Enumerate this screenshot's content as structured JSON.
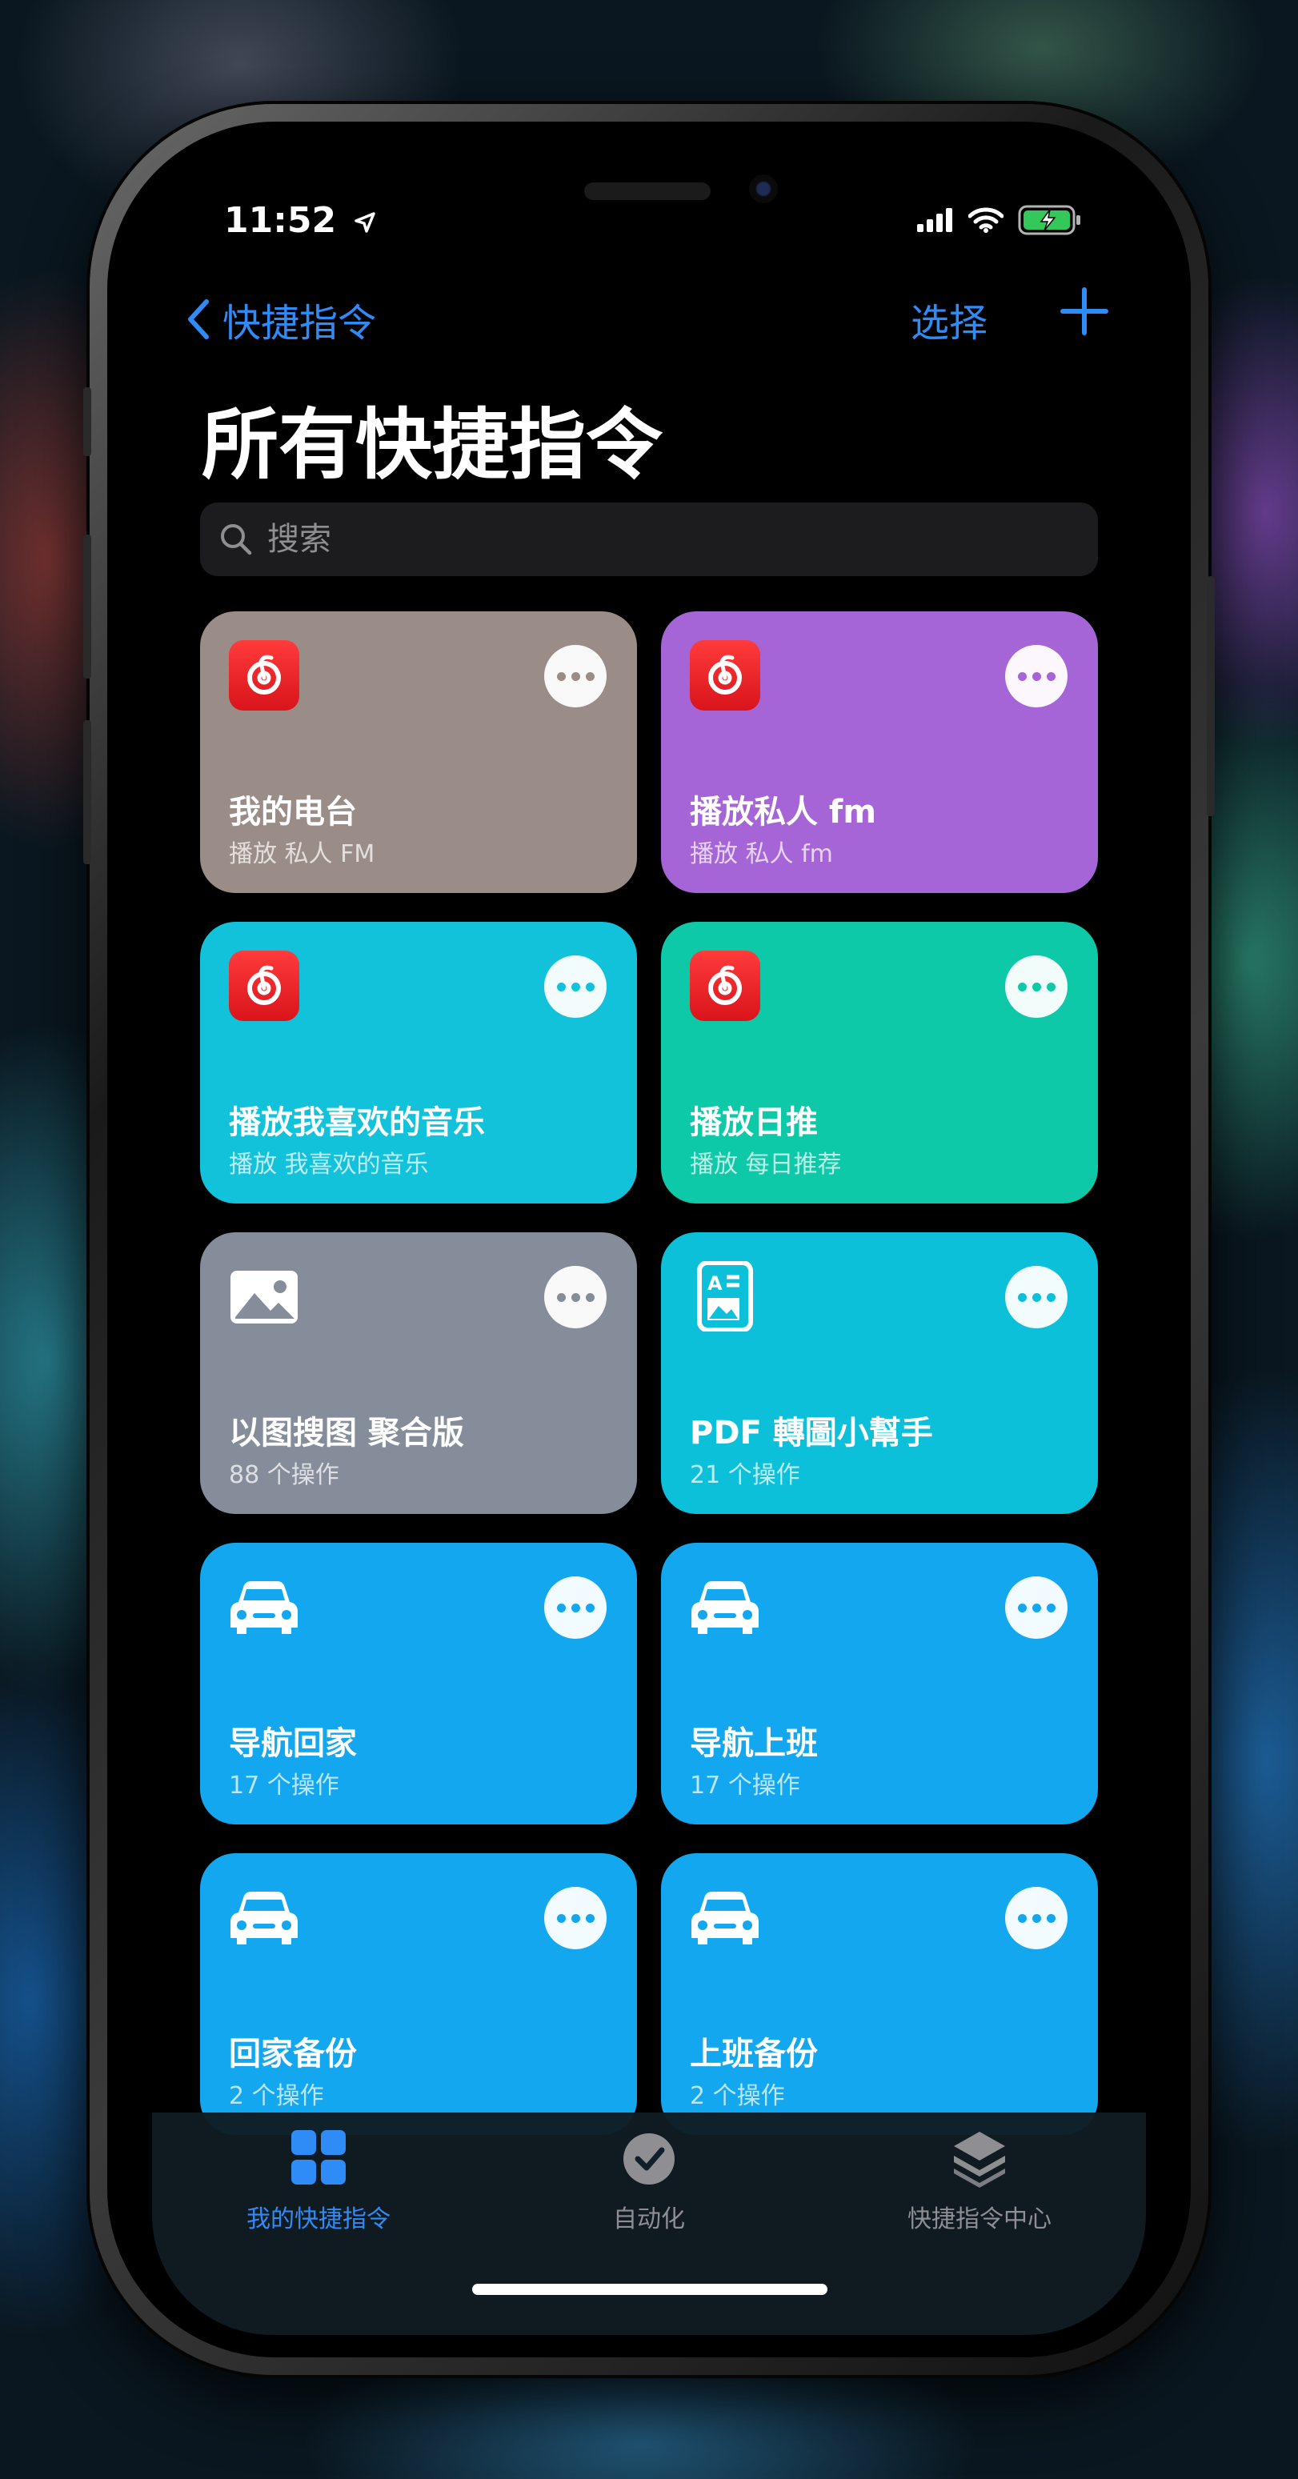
{
  "status_bar": {
    "time": "11:52"
  },
  "nav": {
    "back_label": "快捷指令",
    "select_label": "选择",
    "title": "所有快捷指令"
  },
  "search": {
    "placeholder": "搜索"
  },
  "shortcuts": [
    {
      "title": "我的电台",
      "subtitle": "播放 私人 FM",
      "icon": "netease-music-icon",
      "color": "#9a8c87"
    },
    {
      "title": "播放私人 fm",
      "subtitle": "播放 私人 fm",
      "icon": "netease-music-icon",
      "color": "#a565d6"
    },
    {
      "title": "播放我喜欢的音乐",
      "subtitle": "播放 我喜欢的音乐",
      "icon": "netease-music-icon",
      "color": "#12c2db"
    },
    {
      "title": "播放日推",
      "subtitle": "播放 每日推荐",
      "icon": "netease-music-icon",
      "color": "#0ec9a8"
    },
    {
      "title": "以图搜图 聚合版",
      "subtitle": "88 个操作",
      "icon": "photo-icon",
      "color": "#848d99"
    },
    {
      "title": "PDF 轉圖小幫手",
      "subtitle": "21 个操作",
      "icon": "document-image-icon",
      "color": "#0cc0da"
    },
    {
      "title": "导航回家",
      "subtitle": "17 个操作",
      "icon": "car-icon",
      "color": "#12a7ee"
    },
    {
      "title": "导航上班",
      "subtitle": "17 个操作",
      "icon": "car-icon",
      "color": "#12a7ee"
    },
    {
      "title": "回家备份",
      "subtitle": "2 个操作",
      "icon": "car-icon",
      "color": "#12a7ee"
    },
    {
      "title": "上班备份",
      "subtitle": "2 个操作",
      "icon": "car-icon",
      "color": "#12a7ee"
    }
  ],
  "tabbar": {
    "tabs": [
      {
        "label": "我的快捷指令",
        "icon": "grid-icon",
        "active": true
      },
      {
        "label": "自动化",
        "icon": "clock-check-icon",
        "active": false
      },
      {
        "label": "快捷指令中心",
        "icon": "layers-icon",
        "active": false
      }
    ]
  },
  "colors": {
    "accent": "#2f8cf7",
    "background": "#000000"
  }
}
